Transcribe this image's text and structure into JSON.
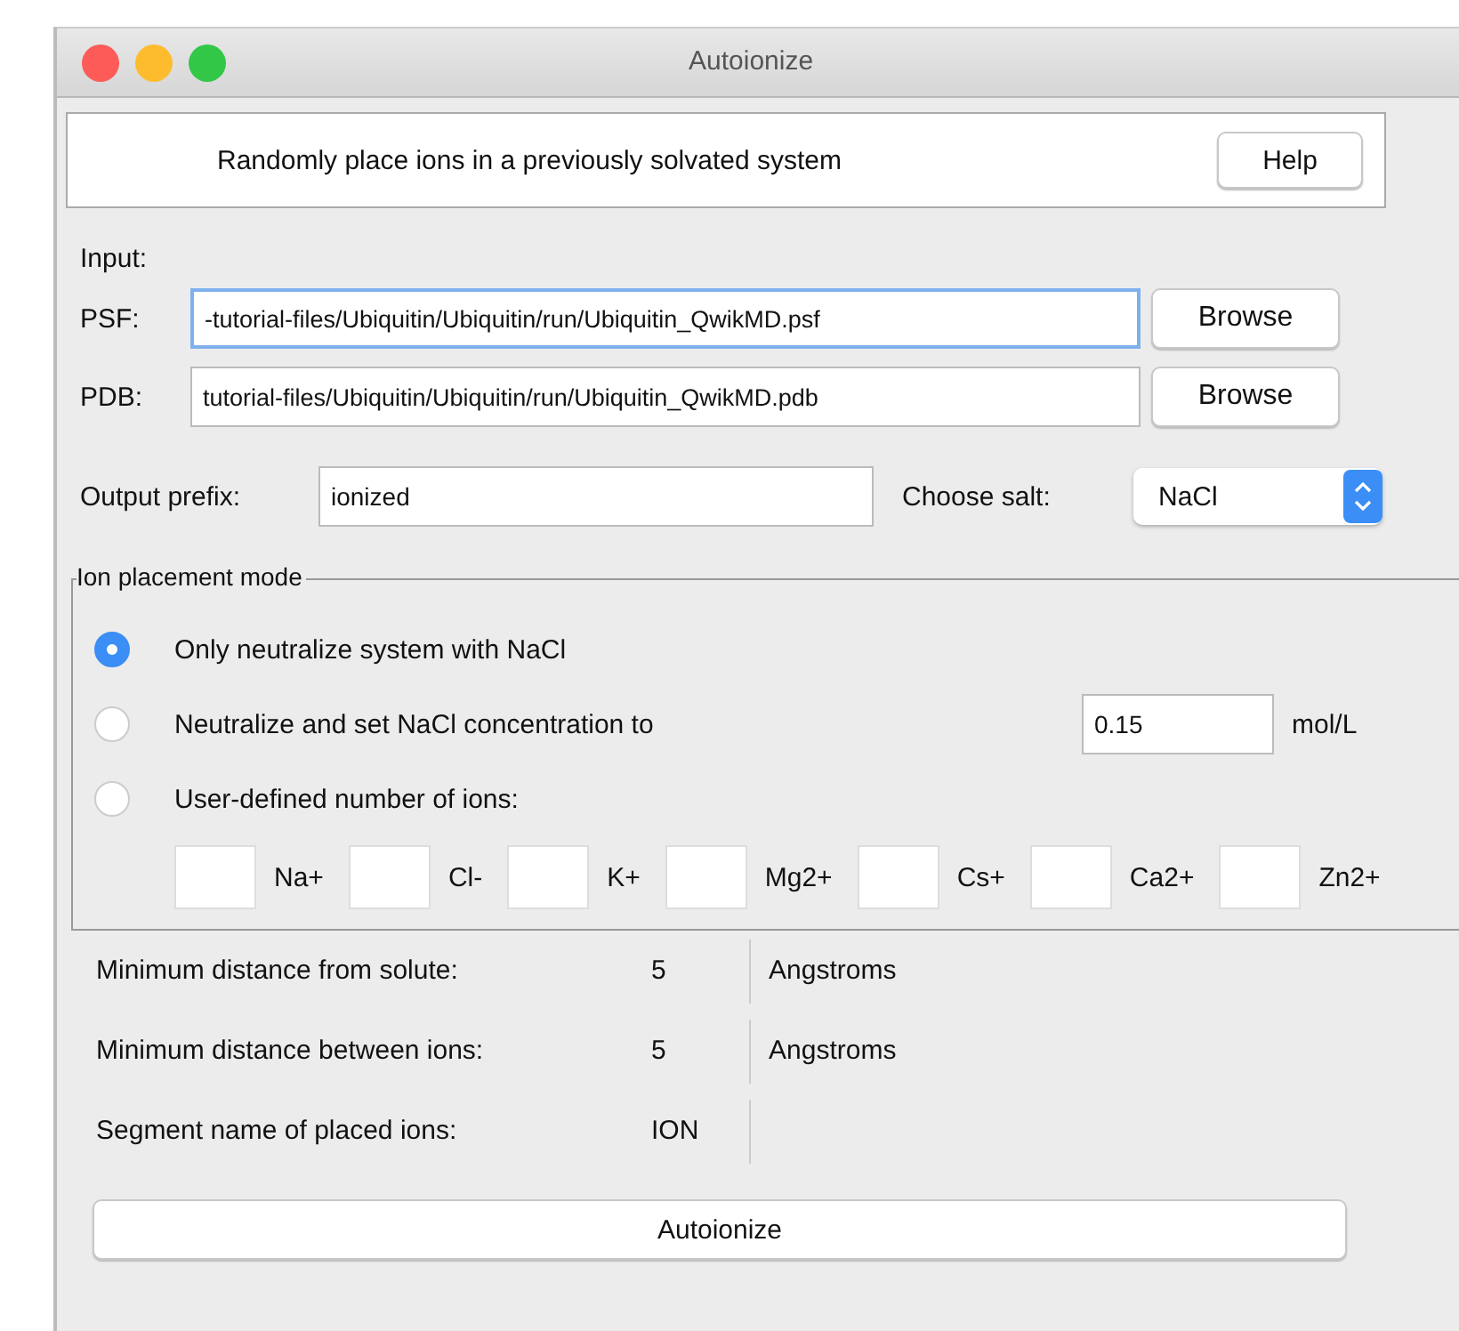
{
  "window": {
    "title": "Autoionize"
  },
  "header": {
    "text": "Randomly place ions in a previously solvated system",
    "help_button": "Help"
  },
  "input": {
    "label": "Input:",
    "files": [
      {
        "label": "PSF:",
        "value": "-tutorial-files/Ubiquitin/Ubiquitin/run/Ubiquitin_QwikMD.psf",
        "focused": true,
        "button": "Browse"
      },
      {
        "label": "PDB:",
        "value": "tutorial-files/Ubiquitin/Ubiquitin/run/Ubiquitin_QwikMD.pdb",
        "focused": false,
        "button": "Browse"
      }
    ]
  },
  "output_prefix": {
    "label": "Output prefix:",
    "value": "ionized"
  },
  "salt": {
    "label": "Choose salt:",
    "value": "NaCl"
  },
  "placement": {
    "title": "Ion placement mode",
    "options": [
      {
        "label": "Only neutralize system with NaCl",
        "selected": true
      },
      {
        "label": "Neutralize and set NaCl concentration to",
        "selected": false,
        "value": "0.15",
        "unit": "mol/L"
      },
      {
        "label": "User-defined number of ions:",
        "selected": false
      }
    ],
    "ions": [
      {
        "label": "Na+"
      },
      {
        "label": "Cl-"
      },
      {
        "label": "K+"
      },
      {
        "label": "Mg2+"
      },
      {
        "label": "Cs+"
      },
      {
        "label": "Ca2+"
      },
      {
        "label": "Zn2+"
      }
    ]
  },
  "settings": [
    {
      "label": "Minimum distance from solute:",
      "value": "5",
      "unit": "Angstroms"
    },
    {
      "label": "Minimum distance between ions:",
      "value": "5",
      "unit": "Angstroms"
    },
    {
      "label": "Segment name of placed ions:",
      "value": "ION"
    }
  ],
  "run_button": "Autoionize"
}
